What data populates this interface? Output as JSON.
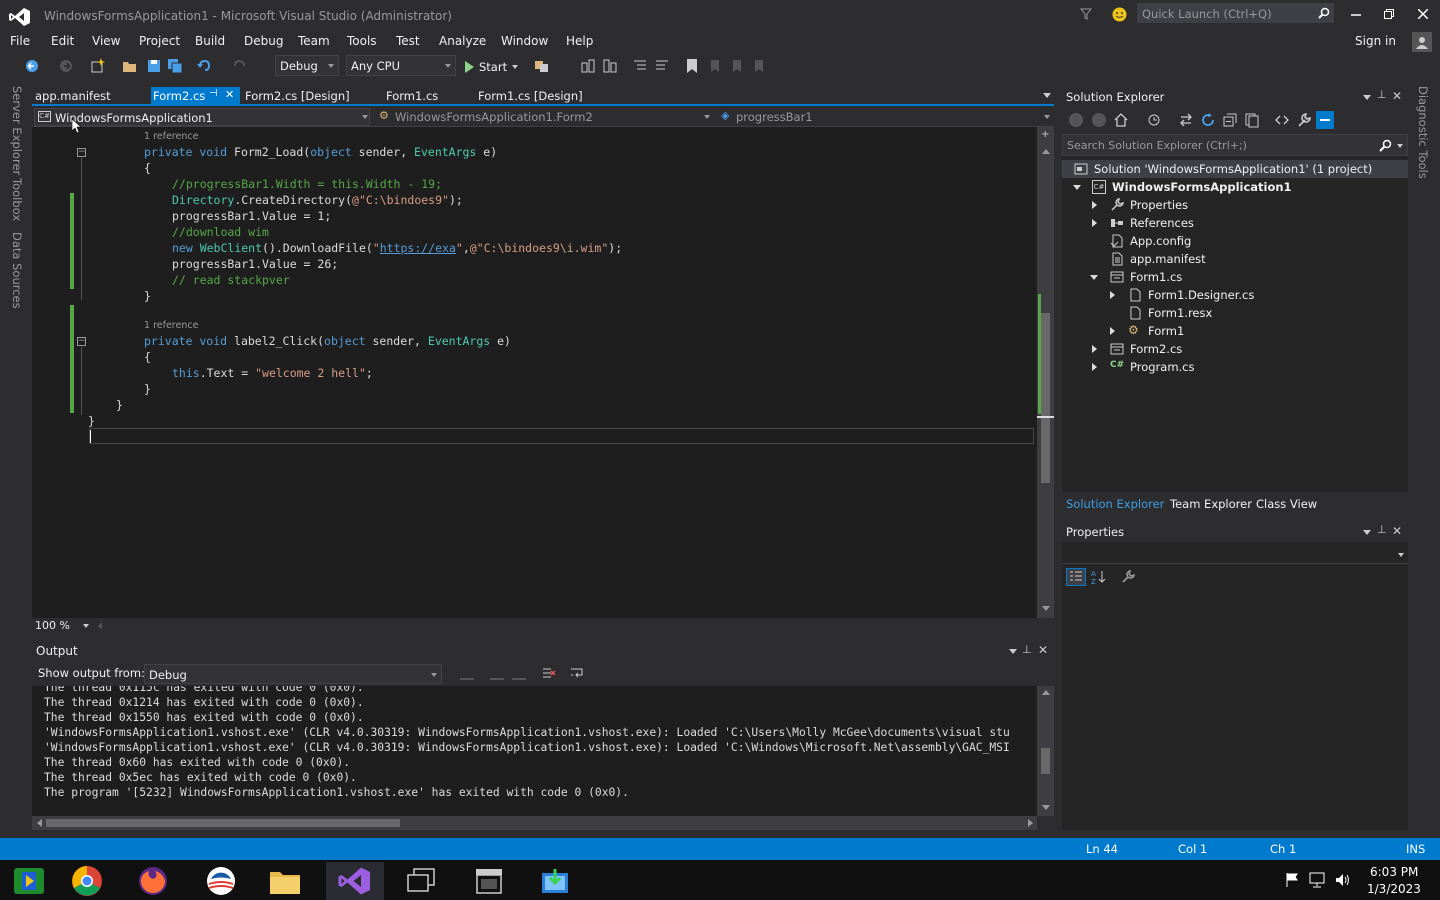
{
  "window": {
    "title": "WindowsFormsApplication1 - Microsoft Visual Studio (Administrator)",
    "quick_launch_placeholder": "Quick Launch (Ctrl+Q)",
    "sign_in": "Sign in"
  },
  "menu": [
    "File",
    "Edit",
    "View",
    "Project",
    "Build",
    "Debug",
    "Team",
    "Tools",
    "Test",
    "Analyze",
    "Window",
    "Help"
  ],
  "toolbar": {
    "config": "Debug",
    "platform": "Any CPU",
    "start_label": "Start"
  },
  "left_strip": [
    "Server Explorer",
    "Toolbox",
    "Data Sources"
  ],
  "right_strip": "Diagnostic Tools",
  "doc_tabs": [
    {
      "label": "app.manifest"
    },
    {
      "label": "Form2.cs"
    },
    {
      "label": "Form2.cs [Design]"
    },
    {
      "label": "Form1.cs"
    },
    {
      "label": "Form1.cs [Design]"
    }
  ],
  "navbar": {
    "project": "WindowsFormsApplication1",
    "class": "WindowsFormsApplication1.Form2",
    "member": "progressBar1"
  },
  "editor": {
    "ref1": "1 reference",
    "ref2": "1 reference",
    "zoom": "100 %",
    "code": {
      "l1_kw": "private void ",
      "l1_name": "Form2_Load(",
      "l1_kw2": "object",
      "l1_mid": " sender, ",
      "l1_type": "EventArgs",
      "l1_end": " e)",
      "l2": "{",
      "l3": "//progressBar1.Width = this.Width - 19;",
      "l4_type": "Directory",
      "l4_mid": ".CreateDirectory(",
      "l4_str": "@\"C:\\bindoes9\"",
      "l4_end": ");",
      "l5": "progressBar1.Value = 1;",
      "l6": "//download wim",
      "l7_kw": "new ",
      "l7_type": "WebClient",
      "l7_mid": "().DownloadFile(",
      "l7_q1": "\"",
      "l7_link": "https://exa",
      "l7_q2": "\"",
      "l7_comma": ",",
      "l7_str": "@\"C:\\bindoes9\\i.wim\"",
      "l7_end": ");",
      "l8": "progressBar1.Value = 26;",
      "l9": "// read stackpver",
      "l10": "}",
      "l11_kw": "private void ",
      "l11_name": "label2_Click(",
      "l11_kw2": "object",
      "l11_mid": " sender, ",
      "l11_type": "EventArgs",
      "l11_end": " e)",
      "l12": "{",
      "l13_kw": "this",
      "l13_mid": ".Text = ",
      "l13_str": "\"welcome 2 hell\"",
      "l13_end": ";",
      "l14": "}",
      "l15": "}",
      "l16": "}"
    }
  },
  "output": {
    "title": "Output",
    "show_from_label": "Show output from:",
    "source": "Debug",
    "lines": [
      "The thread 0x115c has exited with code 0 (0x0).",
      "The thread 0x1214 has exited with code 0 (0x0).",
      "The thread 0x1550 has exited with code 0 (0x0).",
      "'WindowsFormsApplication1.vshost.exe' (CLR v4.0.30319: WindowsFormsApplication1.vshost.exe): Loaded 'C:\\Users\\Molly McGee\\documents\\visual stu",
      "'WindowsFormsApplication1.vshost.exe' (CLR v4.0.30319: WindowsFormsApplication1.vshost.exe): Loaded 'C:\\Windows\\Microsoft.Net\\assembly\\GAC_MSI",
      "The thread 0x60 has exited with code 0 (0x0).",
      "The thread 0x5ec has exited with code 0 (0x0).",
      "The program '[5232] WindowsFormsApplication1.vshost.exe' has exited with code 0 (0x0)."
    ]
  },
  "solution_explorer": {
    "title": "Solution Explorer",
    "search_placeholder": "Search Solution Explorer (Ctrl+;)",
    "items": [
      {
        "label": "Solution 'WindowsFormsApplication1' (1 project)",
        "icon": "solution-icon"
      },
      {
        "label": "WindowsFormsApplication1",
        "icon": "csharp-project-icon"
      },
      {
        "label": "Properties",
        "icon": "wrench-icon"
      },
      {
        "label": "References",
        "icon": "references-icon"
      },
      {
        "label": "App.config",
        "icon": "config-file-icon"
      },
      {
        "label": "app.manifest",
        "icon": "manifest-file-icon"
      },
      {
        "label": "Form1.cs",
        "icon": "form-icon"
      },
      {
        "label": "Form1.Designer.cs",
        "icon": "file-icon"
      },
      {
        "label": "Form1.resx",
        "icon": "file-icon"
      },
      {
        "label": "Form1",
        "icon": "class-icon"
      },
      {
        "label": "Form2.cs",
        "icon": "form-icon"
      },
      {
        "label": "Program.cs",
        "icon": "csharp-file-icon"
      }
    ],
    "bottom_tabs": [
      "Solution Explorer",
      "Team Explorer",
      "Class View"
    ]
  },
  "properties": {
    "title": "Properties"
  },
  "statusbar": {
    "ln": "Ln 44",
    "col": "Col 1",
    "ch": "Ch 1",
    "mode": "INS"
  },
  "taskbar": {
    "time": "6:03 PM",
    "date": "1/3/2023",
    "apps": [
      "windows-media-icon",
      "chrome-icon",
      "firefox-icon",
      "obama-logo-icon",
      "file-explorer-icon",
      "visual-studio-icon",
      "task-view-icon",
      "store-icon",
      "installer-icon"
    ]
  },
  "colors": {
    "accent": "#007acc",
    "editor_bg": "#1e1e1e",
    "chrome": "#2d2d30",
    "keyword": "#569cd6",
    "type": "#4ec9b0",
    "comment": "#57a64a",
    "string": "#d69d85"
  }
}
